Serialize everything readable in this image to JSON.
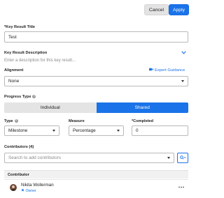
{
  "toolbar": {
    "cancel_label": "Cancel",
    "apply_label": "Apply"
  },
  "title_field": {
    "label": "*Key Result Title",
    "value": "Test"
  },
  "description": {
    "label": "Key Result Description",
    "placeholder": "Enter a description for this key result..."
  },
  "alignment": {
    "label": "Alignment",
    "value": "None",
    "expert_guidance_label": "Expert Guidance"
  },
  "progress": {
    "label": "Progress Type",
    "options": [
      "Individual",
      "Shared"
    ],
    "selected": "Shared"
  },
  "type_field": {
    "label": "Type",
    "value": "Milestone"
  },
  "measure_field": {
    "label": "Measure",
    "value": "Percentage"
  },
  "completed_field": {
    "label": "*Completed",
    "value": "0"
  },
  "contributors": {
    "label": "Contributors (4)",
    "search_placeholder": "Search to add contributors",
    "column_header": "Contributor",
    "rows": [
      {
        "name": "Nikita Wollerman",
        "role": "Owner"
      }
    ]
  },
  "colors": {
    "accent": "#1a73e8"
  }
}
